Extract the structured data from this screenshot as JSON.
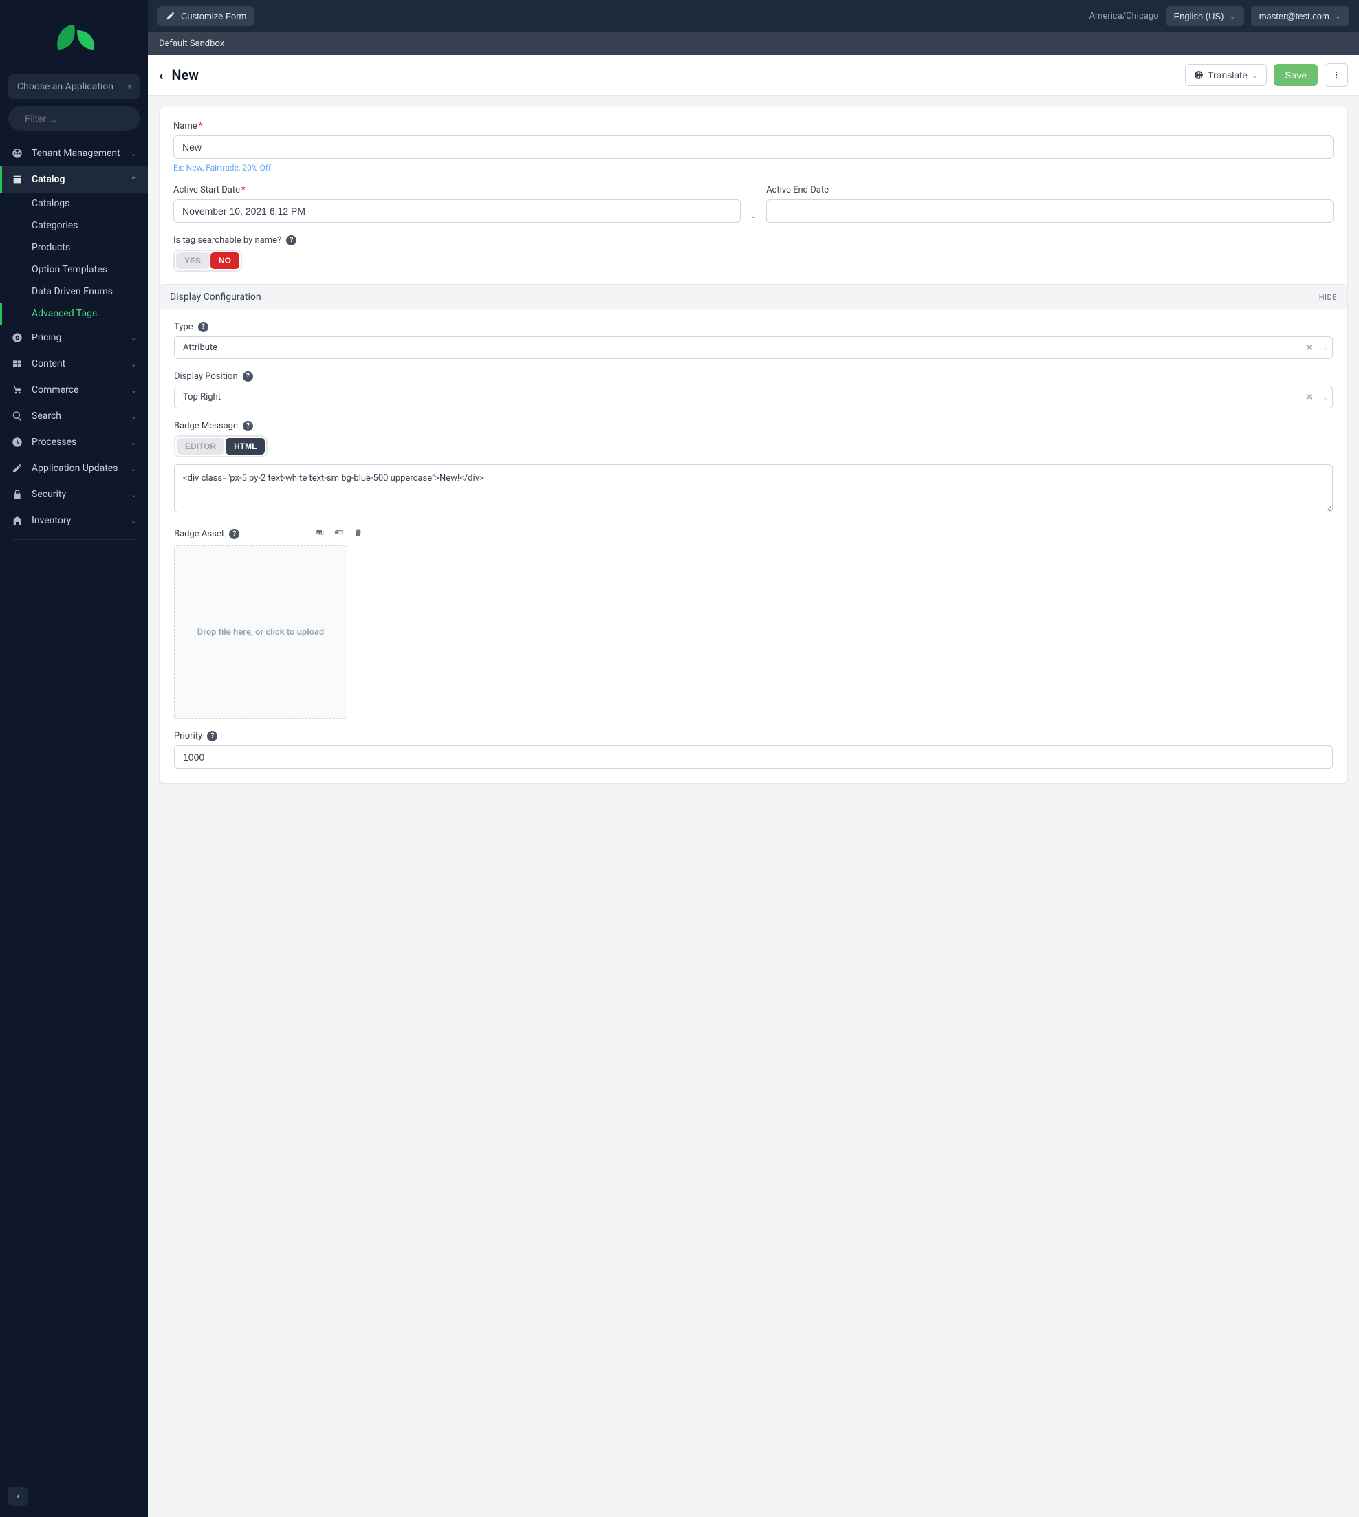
{
  "topbar": {
    "customize": "Customize Form",
    "timezone": "America/Chicago",
    "locale": "English (US)",
    "user": "master@test.com"
  },
  "context": "Default Sandbox",
  "pageHeader": {
    "title": "New",
    "translate": "Translate",
    "save": "Save"
  },
  "sidebar": {
    "appSelectPlaceholder": "Choose an Application",
    "filterPlaceholder": "Filter ...",
    "items": {
      "tenant": "Tenant Management",
      "catalog": "Catalog",
      "pricing": "Pricing",
      "content": "Content",
      "commerce": "Commerce",
      "search": "Search",
      "processes": "Processes",
      "appUpdates": "Application Updates",
      "security": "Security",
      "inventory": "Inventory"
    },
    "catalogSub": {
      "catalogs": "Catalogs",
      "categories": "Categories",
      "products": "Products",
      "optionTemplates": "Option Templates",
      "dataDriven": "Data Driven Enums",
      "advancedTags": "Advanced Tags"
    }
  },
  "form": {
    "nameLabel": "Name",
    "nameValue": "New",
    "nameHint": "Ex: New, Fairtrade, 20% Off",
    "startLabel": "Active Start Date",
    "startValue": "November 10, 2021 6:12 PM",
    "endLabel": "Active End Date",
    "endValue": "",
    "searchableLabel": "Is tag searchable by name?",
    "yes": "YES",
    "no": "NO"
  },
  "display": {
    "sectionTitle": "Display Configuration",
    "hide": "HIDE",
    "typeLabel": "Type",
    "typeValue": "Attribute",
    "positionLabel": "Display Position",
    "positionValue": "Top Right",
    "badgeMsgLabel": "Badge Message",
    "editor": "EDITOR",
    "html": "HTML",
    "badgeHtml": "<div class=\"px-5 py-2 text-white text-sm bg-blue-500 uppercase\">New!</div>",
    "badgeAssetLabel": "Badge Asset",
    "dropzone": "Drop file here, or click to upload",
    "priorityLabel": "Priority",
    "priorityValue": "1000"
  }
}
